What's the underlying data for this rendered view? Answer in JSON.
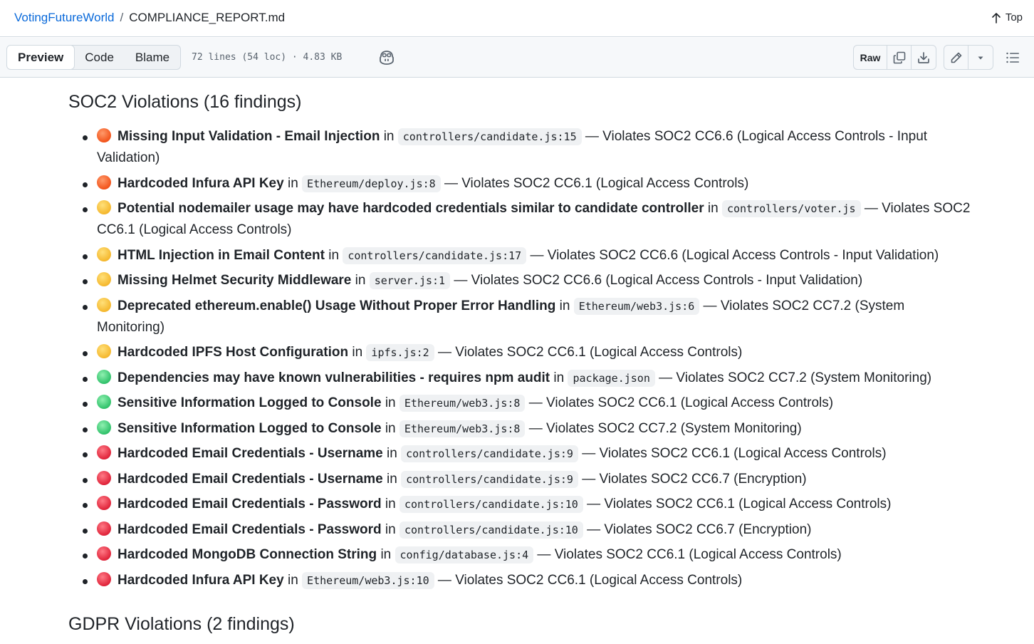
{
  "breadcrumb": {
    "repo": "VotingFutureWorld",
    "separator": "/",
    "file": "COMPLIANCE_REPORT.md"
  },
  "top_link": "Top",
  "view_tabs": [
    "Preview",
    "Code",
    "Blame"
  ],
  "file_meta": "72 lines (54 loc) · 4.83 KB",
  "actions": {
    "raw": "Raw"
  },
  "soc2_heading": "SOC2 Violations (16 findings)",
  "connector_in": "in",
  "findings": [
    {
      "severity": "high",
      "title": "Missing Input Validation - Email Injection",
      "file": "controllers/candidate.js:15",
      "violation": "— Violates SOC2 CC6.6 (Logical Access Controls - Input Validation)"
    },
    {
      "severity": "high",
      "title": "Hardcoded Infura API Key",
      "file": "Ethereum/deploy.js:8",
      "violation": "— Violates SOC2 CC6.1 (Logical Access Controls)"
    },
    {
      "severity": "medium",
      "title": "Potential nodemailer usage may have hardcoded credentials similar to candidate controller",
      "file": "controllers/voter.js",
      "violation": "— Violates SOC2 CC6.1 (Logical Access Controls)"
    },
    {
      "severity": "medium",
      "title": "HTML Injection in Email Content",
      "file": "controllers/candidate.js:17",
      "violation": "— Violates SOC2 CC6.6 (Logical Access Controls - Input Validation)"
    },
    {
      "severity": "medium",
      "title": "Missing Helmet Security Middleware",
      "file": "server.js:1",
      "violation": "— Violates SOC2 CC6.6 (Logical Access Controls - Input Validation)"
    },
    {
      "severity": "medium",
      "title": "Deprecated ethereum.enable() Usage Without Proper Error Handling",
      "file": "Ethereum/web3.js:6",
      "violation": "— Violates SOC2 CC7.2 (System Monitoring)"
    },
    {
      "severity": "medium",
      "title": "Hardcoded IPFS Host Configuration",
      "file": "ipfs.js:2",
      "violation": "— Violates SOC2 CC6.1 (Logical Access Controls)"
    },
    {
      "severity": "low",
      "title": "Dependencies may have known vulnerabilities - requires npm audit",
      "file": "package.json",
      "violation": "— Violates SOC2 CC7.2 (System Monitoring)"
    },
    {
      "severity": "low",
      "title": "Sensitive Information Logged to Console",
      "file": "Ethereum/web3.js:8",
      "violation": "— Violates SOC2 CC6.1 (Logical Access Controls)"
    },
    {
      "severity": "low",
      "title": "Sensitive Information Logged to Console",
      "file": "Ethereum/web3.js:8",
      "violation": "— Violates SOC2 CC7.2 (System Monitoring)"
    },
    {
      "severity": "critical",
      "title": "Hardcoded Email Credentials - Username",
      "file": "controllers/candidate.js:9",
      "violation": "— Violates SOC2 CC6.1 (Logical Access Controls)"
    },
    {
      "severity": "critical",
      "title": "Hardcoded Email Credentials - Username",
      "file": "controllers/candidate.js:9",
      "violation": "— Violates SOC2 CC6.7 (Encryption)"
    },
    {
      "severity": "critical",
      "title": "Hardcoded Email Credentials - Password",
      "file": "controllers/candidate.js:10",
      "violation": "— Violates SOC2 CC6.1 (Logical Access Controls)"
    },
    {
      "severity": "critical",
      "title": "Hardcoded Email Credentials - Password",
      "file": "controllers/candidate.js:10",
      "violation": "— Violates SOC2 CC6.7 (Encryption)"
    },
    {
      "severity": "critical",
      "title": "Hardcoded MongoDB Connection String",
      "file": "config/database.js:4",
      "violation": "— Violates SOC2 CC6.1 (Logical Access Controls)"
    },
    {
      "severity": "critical",
      "title": "Hardcoded Infura API Key",
      "file": "Ethereum/web3.js:10",
      "violation": "— Violates SOC2 CC6.1 (Logical Access Controls)"
    }
  ],
  "gdpr_heading": "GDPR Violations (2 findings)",
  "colors": {
    "link": "#0969da",
    "high": "#f2541b",
    "medium": "#f5b82e",
    "low": "#31c26b",
    "critical": "#e0243a"
  }
}
